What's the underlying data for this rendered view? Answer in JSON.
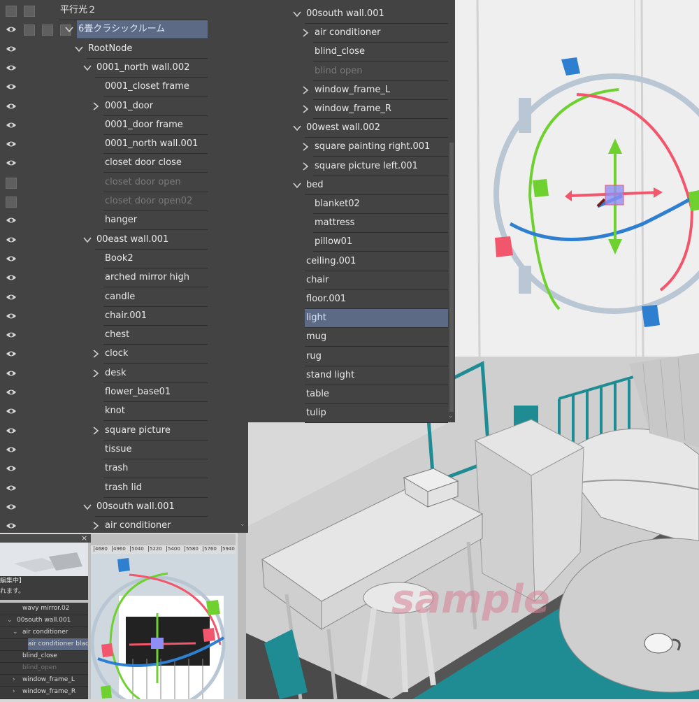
{
  "left_tree": {
    "rows": [
      {
        "label": "平行光２",
        "indent": 86,
        "toggle": "",
        "state": "normal",
        "vis": "checkbox",
        "extra_checks": 2
      },
      {
        "label": "6畳クラシックルーム",
        "indent": 112,
        "toggle": "down",
        "state": "selected",
        "vis": "eye",
        "extra_checks": 3
      },
      {
        "label": "RootNode",
        "indent": 126,
        "toggle": "down",
        "state": "normal",
        "vis": "eye",
        "extra_checks": 0
      },
      {
        "label": "0001_north wall.002",
        "indent": 138,
        "toggle": "down",
        "state": "normal",
        "vis": "eye",
        "extra_checks": 0
      },
      {
        "label": "0001_closet frame",
        "indent": 150,
        "toggle": "",
        "state": "normal",
        "vis": "eye",
        "extra_checks": 0
      },
      {
        "label": "0001_door",
        "indent": 150,
        "toggle": "right",
        "state": "normal",
        "vis": "eye",
        "extra_checks": 0
      },
      {
        "label": "0001_door frame",
        "indent": 150,
        "toggle": "",
        "state": "normal",
        "vis": "eye",
        "extra_checks": 0
      },
      {
        "label": "0001_north wall.001",
        "indent": 150,
        "toggle": "",
        "state": "normal",
        "vis": "eye",
        "extra_checks": 0
      },
      {
        "label": "closet door close",
        "indent": 150,
        "toggle": "",
        "state": "normal",
        "vis": "eye",
        "extra_checks": 0
      },
      {
        "label": "closet door open",
        "indent": 150,
        "toggle": "",
        "state": "dim",
        "vis": "checkbox",
        "extra_checks": 0
      },
      {
        "label": "closet door open02",
        "indent": 150,
        "toggle": "",
        "state": "dim",
        "vis": "checkbox",
        "extra_checks": 0
      },
      {
        "label": "hanger",
        "indent": 150,
        "toggle": "",
        "state": "normal",
        "vis": "eye",
        "extra_checks": 0
      },
      {
        "label": "00east wall.001",
        "indent": 138,
        "toggle": "down",
        "state": "normal",
        "vis": "eye",
        "extra_checks": 0
      },
      {
        "label": "Book2",
        "indent": 150,
        "toggle": "",
        "state": "normal",
        "vis": "eye",
        "extra_checks": 0
      },
      {
        "label": "arched mirror high",
        "indent": 150,
        "toggle": "",
        "state": "normal",
        "vis": "eye",
        "extra_checks": 0
      },
      {
        "label": "candle",
        "indent": 150,
        "toggle": "",
        "state": "normal",
        "vis": "eye",
        "extra_checks": 0
      },
      {
        "label": "chair.001",
        "indent": 150,
        "toggle": "",
        "state": "normal",
        "vis": "eye",
        "extra_checks": 0
      },
      {
        "label": "chest",
        "indent": 150,
        "toggle": "",
        "state": "normal",
        "vis": "eye",
        "extra_checks": 0
      },
      {
        "label": "clock",
        "indent": 150,
        "toggle": "right",
        "state": "normal",
        "vis": "eye",
        "extra_checks": 0
      },
      {
        "label": "desk",
        "indent": 150,
        "toggle": "right",
        "state": "normal",
        "vis": "eye",
        "extra_checks": 0
      },
      {
        "label": "flower_base01",
        "indent": 150,
        "toggle": "",
        "state": "normal",
        "vis": "eye",
        "extra_checks": 0
      },
      {
        "label": "knot",
        "indent": 150,
        "toggle": "",
        "state": "normal",
        "vis": "eye",
        "extra_checks": 0
      },
      {
        "label": "square picture",
        "indent": 150,
        "toggle": "right",
        "state": "normal",
        "vis": "eye",
        "extra_checks": 0
      },
      {
        "label": "tissue",
        "indent": 150,
        "toggle": "",
        "state": "normal",
        "vis": "eye",
        "extra_checks": 0
      },
      {
        "label": "trash",
        "indent": 150,
        "toggle": "",
        "state": "normal",
        "vis": "eye",
        "extra_checks": 0
      },
      {
        "label": "trash lid",
        "indent": 150,
        "toggle": "",
        "state": "normal",
        "vis": "eye",
        "extra_checks": 0
      },
      {
        "label": "00south wall.001",
        "indent": 138,
        "toggle": "down",
        "state": "normal",
        "vis": "eye",
        "extra_checks": 0
      },
      {
        "label": "air conditioner",
        "indent": 150,
        "toggle": "right",
        "state": "normal",
        "vis": "eye",
        "extra_checks": 0
      }
    ]
  },
  "right_tree": {
    "rows": [
      {
        "label": "00south wall.001",
        "indent": 438,
        "toggle": "down",
        "state": "normal",
        "vis": "eye"
      },
      {
        "label": "air conditioner",
        "indent": 450,
        "toggle": "right",
        "state": "normal",
        "vis": "eye"
      },
      {
        "label": "blind_close",
        "indent": 450,
        "toggle": "",
        "state": "normal",
        "vis": "eye"
      },
      {
        "label": "blind open",
        "indent": 450,
        "toggle": "",
        "state": "dim",
        "vis": "checkbox"
      },
      {
        "label": "window_frame_L",
        "indent": 450,
        "toggle": "right",
        "state": "normal",
        "vis": "eye"
      },
      {
        "label": "window_frame_R",
        "indent": 450,
        "toggle": "right",
        "state": "normal",
        "vis": "eye"
      },
      {
        "label": "00west wall.002",
        "indent": 438,
        "toggle": "down",
        "state": "normal",
        "vis": "eye"
      },
      {
        "label": "square painting right.001",
        "indent": 450,
        "toggle": "right",
        "state": "normal",
        "vis": "eye"
      },
      {
        "label": "square picture left.001",
        "indent": 450,
        "toggle": "right",
        "state": "normal",
        "vis": "eye"
      },
      {
        "label": "bed",
        "indent": 438,
        "toggle": "down",
        "state": "normal",
        "vis": "eye"
      },
      {
        "label": "blanket02",
        "indent": 450,
        "toggle": "",
        "state": "normal",
        "vis": "eye"
      },
      {
        "label": "mattress",
        "indent": 450,
        "toggle": "",
        "state": "normal",
        "vis": "eye"
      },
      {
        "label": "pillow01",
        "indent": 450,
        "toggle": "",
        "state": "normal",
        "vis": "eye"
      },
      {
        "label": "ceiling.001",
        "indent": 438,
        "toggle": "",
        "state": "normal",
        "vis": "eye"
      },
      {
        "label": "chair",
        "indent": 438,
        "toggle": "",
        "state": "normal",
        "vis": "eye"
      },
      {
        "label": "floor.001",
        "indent": 438,
        "toggle": "",
        "state": "normal",
        "vis": "eye"
      },
      {
        "label": "light",
        "indent": 438,
        "toggle": "",
        "state": "selected",
        "vis": "eye"
      },
      {
        "label": "mug",
        "indent": 438,
        "toggle": "",
        "state": "normal",
        "vis": "eye"
      },
      {
        "label": "rug",
        "indent": 438,
        "toggle": "",
        "state": "normal",
        "vis": "eye"
      },
      {
        "label": "stand light",
        "indent": 438,
        "toggle": "",
        "state": "normal",
        "vis": "eye"
      },
      {
        "label": "table",
        "indent": 438,
        "toggle": "",
        "state": "normal",
        "vis": "eye"
      },
      {
        "label": "tulip",
        "indent": 438,
        "toggle": "",
        "state": "normal",
        "vis": "eye"
      }
    ]
  },
  "mini_window": {
    "close_glyph": "×",
    "status_line1": "編集中】",
    "status_line2": "れます。",
    "ruler_labels": [
      "4680",
      "4960",
      "5040",
      "5220",
      "5400",
      "5580",
      "5760",
      "5940"
    ],
    "tree": [
      {
        "label": "wavy mirror.02",
        "indent": 32,
        "toggle": "",
        "state": "normal"
      },
      {
        "label": "00south wall.001",
        "indent": 24,
        "toggle": "down",
        "state": "normal"
      },
      {
        "label": "air conditioner",
        "indent": 32,
        "toggle": "down",
        "state": "normal"
      },
      {
        "label": "air conditioner blades",
        "indent": 40,
        "toggle": "",
        "state": "selected"
      },
      {
        "label": "blind_close",
        "indent": 32,
        "toggle": "",
        "state": "normal"
      },
      {
        "label": "blind_open",
        "indent": 32,
        "toggle": "",
        "state": "dim"
      },
      {
        "label": "window_frame_L",
        "indent": 32,
        "toggle": "right",
        "state": "normal"
      },
      {
        "label": "window_frame_R",
        "indent": 32,
        "toggle": "right",
        "state": "normal"
      }
    ]
  },
  "watermark": "sample",
  "colors": {
    "panel_bg": "#434343",
    "selected_row": "#5c6a86",
    "gizmo_red": "#f2566c",
    "gizmo_green": "#6ed130",
    "gizmo_blue": "#2f7fd1",
    "ring_gray": "#b9c6d3",
    "teal": "#1f8c94"
  }
}
